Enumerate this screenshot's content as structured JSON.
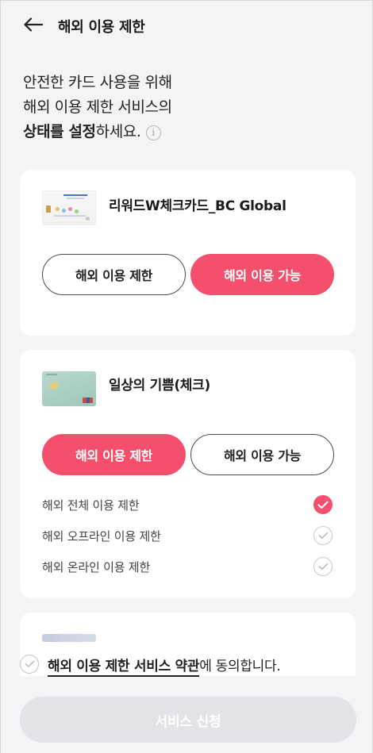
{
  "header": {
    "title": "해외 이용 제한",
    "back_icon": "arrow-left-icon"
  },
  "intro": {
    "line1": "안전한 카드 사용을 위해",
    "line2": "해외 이용 제한 서비스의",
    "line3_bold": "상태를 설정",
    "line3_rest": "하세요.",
    "info_icon_glyph": "i"
  },
  "cards": [
    {
      "name": "리워드W체크카드_BC Global",
      "restrict_label": "해외 이용 제한",
      "allow_label": "해외 이용 가능",
      "selected": "allow"
    },
    {
      "name": "일상의 기쁨(체크)",
      "restrict_label": "해외 이용 제한",
      "allow_label": "해외 이용 가능",
      "selected": "restrict",
      "options": [
        {
          "label": "해외 전체 이용 제한",
          "checked": true
        },
        {
          "label": "해외 오프라인 이용 제한",
          "checked": false
        },
        {
          "label": "해외 온라인 이용 제한",
          "checked": false
        }
      ]
    }
  ],
  "agreement": {
    "link_text": "해외 이용 제한 서비스 약관",
    "suffix": "에 동의합니다.",
    "checked": false
  },
  "submit": {
    "label": "서비스 신청",
    "enabled": false
  },
  "colors": {
    "accent": "#f4506d",
    "background": "#f3f4f6",
    "disabled_button": "#e1e3e6"
  }
}
